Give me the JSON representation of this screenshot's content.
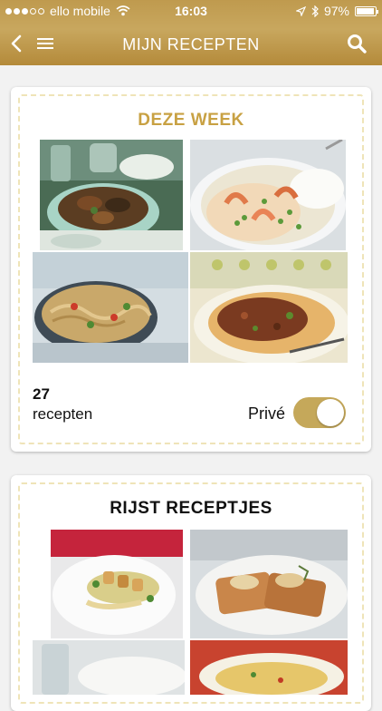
{
  "status_bar": {
    "carrier": "ello mobile",
    "time": "16:03",
    "battery": "97%",
    "battery_level": 0.97
  },
  "navbar": {
    "title": "MIJN RECEPTEN",
    "back_icon": "back-chevron-icon",
    "menu_icon": "hamburger-menu-icon",
    "search_icon": "search-icon"
  },
  "cards": [
    {
      "title": "DEZE WEEK",
      "title_color": "#c8a143",
      "count": "27",
      "count_label": "recepten",
      "privacy_label": "Privé",
      "privacy_on": true,
      "photos": [
        "grilled shrimp with herbs",
        "shrimp curry with peas and rice",
        "stir-fried noodles with vegetables",
        "pappardelle with ragu"
      ]
    },
    {
      "title": "RIJST RECEPTJES",
      "title_color": "#111111",
      "photos": [
        "seafood skewers on salad",
        "bruschetta with mushrooms and thyme",
        "white dish with glass",
        "rice dish"
      ]
    }
  ],
  "colors": {
    "header_gold": "#bf9a4e",
    "accent": "#c5a85a"
  }
}
